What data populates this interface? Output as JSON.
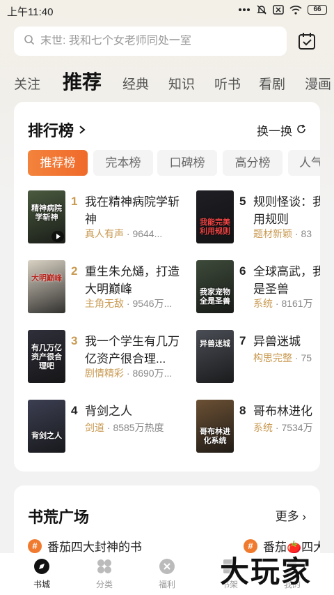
{
  "status_bar": {
    "time": "上午11:40",
    "battery": "66"
  },
  "search": {
    "placeholder": "末世: 我和七个女老师同处一室"
  },
  "top_tabs": [
    "关注",
    "推荐",
    "经典",
    "知识",
    "听书",
    "看剧",
    "漫画"
  ],
  "ranking": {
    "title": "排行榜",
    "switch_label": "换一换",
    "chips": [
      "推荐榜",
      "完本榜",
      "口碑榜",
      "高分榜",
      "人气"
    ],
    "books": [
      {
        "rank": "1",
        "title": "我在精神病院学斩神",
        "tag": "真人有声",
        "heat": "9644...",
        "cover_text": "精神病院学斩神",
        "cover_color": "#4a5a3f"
      },
      {
        "rank": "2",
        "title": "重生朱允熥，打造大明巅峰",
        "tag": "主角无敌",
        "heat": "9546万...",
        "cover_text": "大明巅峰",
        "cover_color": "#d9d2c4"
      },
      {
        "rank": "3",
        "title": "我一个学生有几万亿资产很合理...",
        "tag": "剧情精彩",
        "heat": "8690万...",
        "cover_text": "有几万亿资产很合理吧",
        "cover_color": "#2f2f3a"
      },
      {
        "rank": "4",
        "title": "背剑之人",
        "tag": "剑道",
        "heat": "8585万热度",
        "cover_text": "背剑之人",
        "cover_color": "#3c3f52"
      },
      {
        "rank": "5",
        "title": "规则怪谈：我美利用规则",
        "tag": "题材新颖",
        "heat": "83",
        "cover_text": "我能完美利用规则",
        "cover_color": "#1e1e24"
      },
      {
        "rank": "6",
        "title": "全球高武，我物全是圣兽",
        "tag": "系统",
        "heat": "8161万",
        "cover_text": "我家宠物全是圣兽",
        "cover_color": "#3d4a3a"
      },
      {
        "rank": "7",
        "title": "异兽迷城",
        "tag": "构思完整",
        "heat": "75",
        "cover_text": "异兽迷城",
        "cover_color": "#4a4d55"
      },
      {
        "rank": "8",
        "title": "哥布林进化",
        "tag": "系统",
        "heat": "7534万",
        "cover_text": "哥布林进化系统",
        "cover_color": "#6b5034"
      }
    ]
  },
  "book_section": {
    "title": "书荒广场",
    "more_label": "更多",
    "items": [
      "番茄四大封神的书",
      "番茄🍅四大"
    ]
  },
  "bottom_nav": [
    {
      "label": "书城",
      "active": true
    },
    {
      "label": "分类",
      "active": false
    },
    {
      "label": "福利",
      "active": false
    },
    {
      "label": "书架",
      "active": false
    },
    {
      "label": "我的",
      "active": false
    }
  ],
  "watermark": "大玩家",
  "colors": {
    "accent": "#f06a2a",
    "tag": "#c99a52",
    "rank_top": "#c99a52",
    "rank_other": "#222222"
  }
}
